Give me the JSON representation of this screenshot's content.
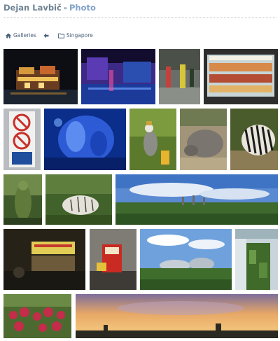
{
  "header": {
    "site_name": "Dejan Lavbič",
    "separator": "»",
    "section": "Photo"
  },
  "breadcrumb": {
    "galleries_label": "Galleries",
    "album_label": "Singapore",
    "icons": [
      "home-icon",
      "arrow-left-icon",
      "folder-icon"
    ]
  },
  "colors": {
    "header_text": "#6c8192",
    "header_accent": "#7ea2c9",
    "breadcrumb_text": "#49607a",
    "background": "#ffffff"
  },
  "gallery": {
    "photos": [
      "night-building-lights",
      "blue-lit-harbor-night",
      "street-performers",
      "food-display-case",
      "no-smoking-sign",
      "blue-aquarium-sculpture",
      "crowned-crane-bird",
      "rhinoceros",
      "zebra",
      "leaf-covered-statue",
      "white-tiger",
      "gardens-skyline-view",
      "hawker-food-stall",
      "red-vending-machine",
      "flower-dome-conservatories",
      "vertical-garden-wall",
      "red-flower-bed",
      "sunset-panorama"
    ]
  }
}
